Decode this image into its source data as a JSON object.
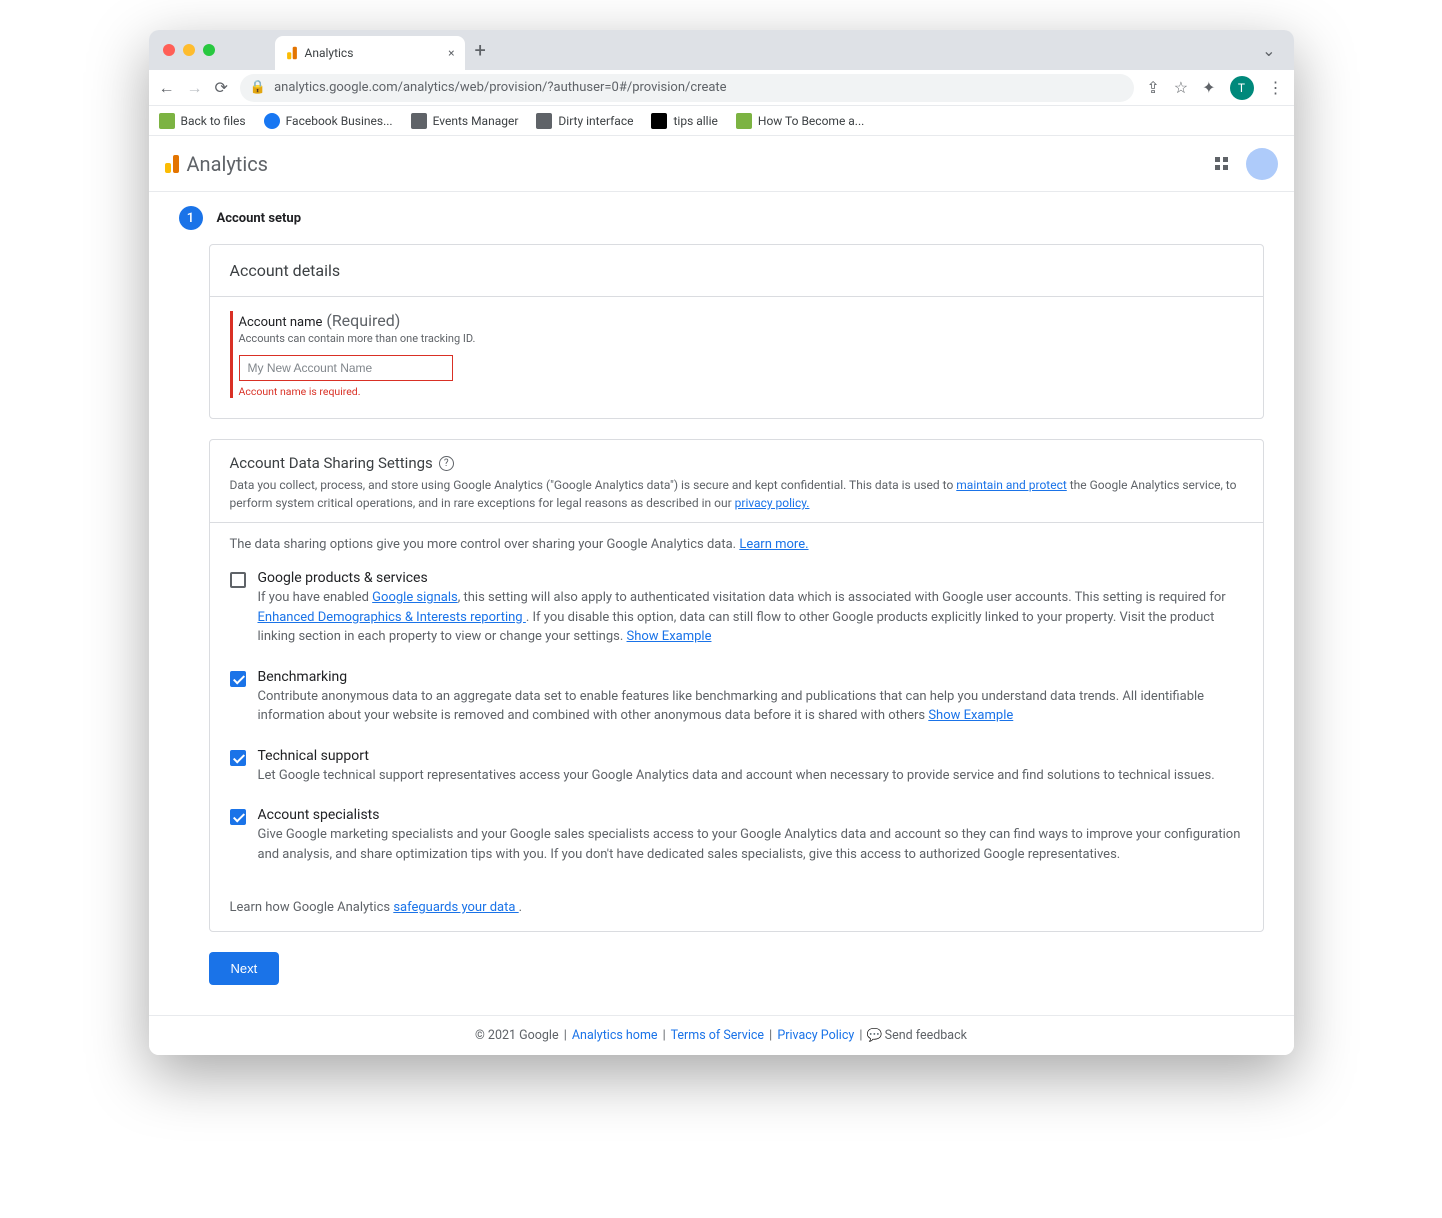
{
  "browser": {
    "tab_title": "Analytics",
    "url": "analytics.google.com/analytics/web/provision/?authuser=0#/provision/create",
    "avatar_letter": "T",
    "bookmarks": [
      "Back to files",
      "Facebook Busines...",
      "Events Manager",
      "Dirty interface",
      "tips allie",
      "How To Become a..."
    ]
  },
  "app": {
    "name": "Analytics"
  },
  "step": {
    "number": "1",
    "title": "Account setup"
  },
  "account_details": {
    "header": "Account details",
    "label": "Account name",
    "required": "(Required)",
    "help": "Accounts can contain more than one tracking ID.",
    "placeholder": "My New Account Name",
    "error": "Account name is required."
  },
  "sharing": {
    "title": "Account Data Sharing Settings",
    "desc_pre": "Data you collect, process, and store using Google Analytics (\"Google Analytics data\") is secure and kept confidential. This data is used to ",
    "link1": "maintain and protect",
    "desc_mid": " the Google Analytics service, to perform system critical operations, and in rare exceptions for legal reasons as described in our ",
    "link2": "privacy policy.",
    "intro": "The data sharing options give you more control over sharing your Google Analytics data. ",
    "learn_more": "Learn more.",
    "options": [
      {
        "title": "Google products & services",
        "desc_parts": [
          "If you have enabled ",
          "Google signals",
          ", this setting will also apply to authenticated visitation data which is associated with Google user accounts. This setting is required for ",
          "Enhanced Demographics & Interests reporting ",
          ". If you disable this option, data can still flow to other Google products explicitly linked to your property. Visit the product linking section in each property to view or change your settings.   "
        ],
        "show_example": "Show Example",
        "checked": false
      },
      {
        "title": "Benchmarking",
        "desc": "Contribute anonymous data to an aggregate data set to enable features like benchmarking and publications that can help you understand data trends. All identifiable information about your website is removed and combined with other anonymous data before it is shared with others   ",
        "show_example": "Show Example",
        "checked": true
      },
      {
        "title": "Technical support",
        "desc": "Let Google technical support representatives access your Google Analytics data and account when necessary to provide service and find solutions to technical issues.",
        "checked": true
      },
      {
        "title": "Account specialists",
        "desc": "Give Google marketing specialists and your Google sales specialists access to your Google Analytics data and account so they can find ways to improve your configuration and analysis, and share optimization tips with you. If you don't have dedicated sales specialists, give this access to authorized Google representatives.",
        "checked": true
      }
    ],
    "safeguard_pre": "Learn how Google Analytics ",
    "safeguard_link": "safeguards your data ",
    "safeguard_post": "."
  },
  "next": "Next",
  "footer": {
    "copyright": "© 2021 Google",
    "links": [
      "Analytics home",
      "Terms of Service",
      "Privacy Policy"
    ],
    "feedback": "Send feedback"
  }
}
